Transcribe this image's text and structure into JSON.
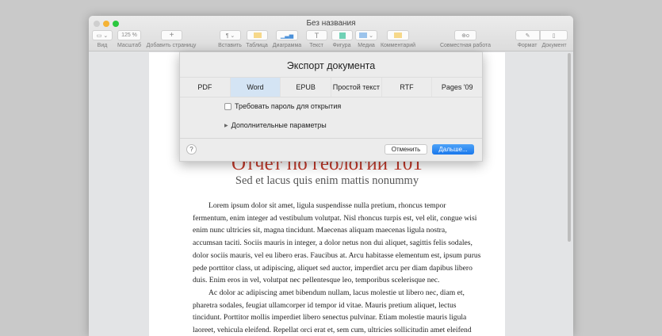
{
  "window": {
    "title": "Без названия"
  },
  "toolbar": {
    "zoom_value": "125 %",
    "items": {
      "view": "Вид",
      "zoom": "Масштаб",
      "add_page": "Добавить страницу",
      "insert": "Вставить",
      "table": "Таблица",
      "chart": "Диаграмма",
      "text": "Текст",
      "shape": "Фигура",
      "media": "Медиа",
      "comment": "Комментарий",
      "collaborate": "Совместная работа",
      "format": "Формат",
      "document": "Документ"
    }
  },
  "document": {
    "title": "Отчет по геологии 101",
    "subtitle": "Sed et lacus quis enim mattis nonummy",
    "lines": [
      "Lorem ipsum dolor sit amet, ligula suspendisse nulla pretium, rhoncus tempor",
      "fermentum, enim integer ad vestibulum volutpat. Nisl rhoncus turpis est, vel elit, congue wisi",
      "enim nunc ultricies sit, magna tincidunt. Maecenas aliquam maecenas ligula nostra,",
      "accumsan taciti. Sociis mauris in integer, a dolor netus non dui aliquet, sagittis felis sodales,",
      "dolor sociis mauris, vel eu libero eras. Faucibus at. Arcu habitasse elementum est, ipsum purus",
      "pede porttitor class, ut adipiscing, aliquet sed auctor, imperdiet arcu per diam dapibus libero",
      "duis. Enim eros in vel, volutpat nec pellentesque leo, temporibus scelerisque nec.",
      "Ac dolor ac adipiscing amet bibendum nullam, lacus molestie ut libero nec, diam et,",
      "pharetra sodales, feugiat ullamcorper id tempor id vitae. Mauris pretium aliquet, lectus",
      "tincidunt. Porttitor mollis imperdiet libero senectus pulvinar. Etiam molestie mauris ligula",
      "laoreet, vehicula eleifend. Repellat orci erat et, sem cum, ultricies sollicitudin amet eleifend"
    ]
  },
  "dialog": {
    "title": "Экспорт документа",
    "tabs": [
      "PDF",
      "Word",
      "EPUB",
      "Простой текст",
      "RTF",
      "Pages '09"
    ],
    "selected_tab": "Word",
    "password_label": "Требовать пароль для открытия",
    "password_checked": false,
    "advanced_label": "Дополнительные параметры",
    "help": "?",
    "cancel": "Отменить",
    "next": "Дальше..."
  },
  "colors": {
    "accent": "#1a78ec",
    "title_red": "#c0392b"
  }
}
